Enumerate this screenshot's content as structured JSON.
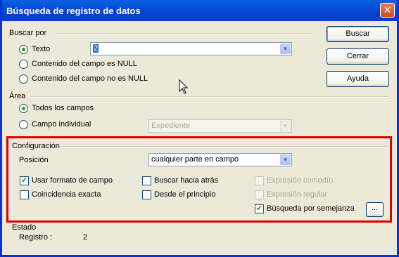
{
  "window": {
    "title": "Búsqueda de registro de datos",
    "close_label": "✕"
  },
  "buscar_por": {
    "label": "Buscar por",
    "options": [
      {
        "label": "Texto",
        "selected": true
      },
      {
        "label": "Contenido del campo es NULL",
        "selected": false
      },
      {
        "label": "Contenido del campo no es NULL",
        "selected": false
      }
    ],
    "text_value": "2"
  },
  "area": {
    "label": "Área",
    "options": [
      {
        "label": "Todos los campos",
        "selected": true
      },
      {
        "label": "Campo individual",
        "selected": false
      }
    ],
    "field_value": "Expediente"
  },
  "config": {
    "label": "Configuración",
    "posicion_label": "Posición",
    "posicion_value": "cualquier parte en campo",
    "checkboxes": [
      {
        "label": "Usar formato de campo",
        "checked": true,
        "enabled": true
      },
      {
        "label": "Coincidencia exacta",
        "checked": false,
        "enabled": true
      },
      {
        "label": "Buscar hacia atrás",
        "checked": false,
        "enabled": true
      },
      {
        "label": "Desde el principio",
        "checked": false,
        "enabled": true
      },
      {
        "label": "Expresión comodín",
        "checked": false,
        "enabled": false
      },
      {
        "label": "Expresión regular",
        "checked": false,
        "enabled": false
      },
      {
        "label": "Búsqueda por semejanza",
        "checked": true,
        "enabled": true
      }
    ],
    "similarity_button": "..."
  },
  "estado": {
    "label": "Estado",
    "registro_label": "Registro :",
    "registro_value": "2"
  },
  "buttons": {
    "buscar": "Buscar",
    "cerrar": "Cerrar",
    "ayuda": "Ayuda"
  },
  "check_glyph": "✔"
}
